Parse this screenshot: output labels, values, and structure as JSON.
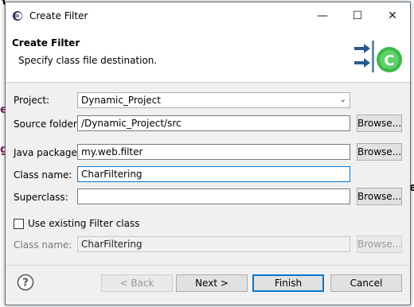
{
  "dialog": {
    "title": "Create Filter",
    "window_controls": {
      "minimize": "—",
      "maximize": "☐",
      "close": "✕"
    }
  },
  "banner": {
    "title": "Create Filter",
    "description": "Specify class file destination."
  },
  "form": {
    "project": {
      "label": "Project:",
      "value": "Dynamic_Project"
    },
    "source_folder": {
      "label": "Source folder:",
      "value": "/Dynamic_Project/src",
      "browse": "Browse..."
    },
    "java_package": {
      "label": "Java package:",
      "value": "my.web.filter",
      "browse": "Browse..."
    },
    "class_name": {
      "label": "Class name:",
      "value": "CharFiltering"
    },
    "superclass": {
      "label": "Superclass:",
      "value": "",
      "browse": "Browse..."
    },
    "use_existing": {
      "label": "Use existing Filter class",
      "checked": false
    },
    "existing_class": {
      "label": "Class name:",
      "value": "CharFiltering",
      "browse": "Browse..."
    }
  },
  "buttons": {
    "back": "< Back",
    "next": "Next >",
    "finish": "Finish",
    "cancel": "Cancel"
  },
  "colors": {
    "focus": "#0078d7",
    "banner_icon_green": "#3cb84a",
    "banner_icon_arrow": "#2a5a8a"
  }
}
